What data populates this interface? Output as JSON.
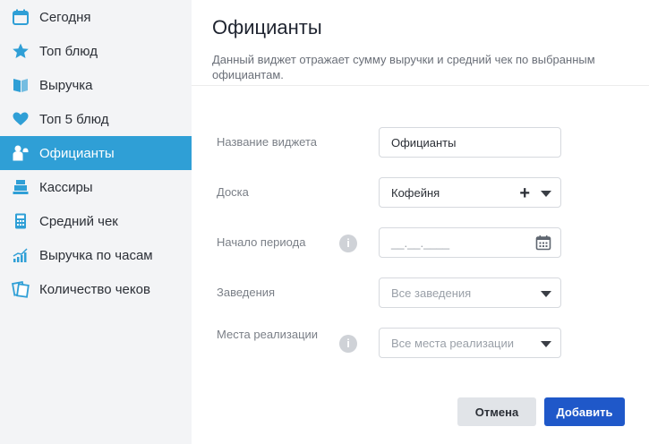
{
  "sidebar": {
    "items": [
      {
        "label": "Сегодня",
        "icon": "calendar-icon",
        "active": false
      },
      {
        "label": "Топ блюд",
        "icon": "star-icon",
        "active": false
      },
      {
        "label": "Выручка",
        "icon": "book-icon",
        "active": false
      },
      {
        "label": "Топ 5 блюд",
        "icon": "heart-icon",
        "active": false
      },
      {
        "label": "Официанты",
        "icon": "waiter-icon",
        "active": true
      },
      {
        "label": "Кассиры",
        "icon": "cash-register-icon",
        "active": false
      },
      {
        "label": "Средний чек",
        "icon": "calculator-icon",
        "active": false
      },
      {
        "label": "Выручка по часам",
        "icon": "chart-icon",
        "active": false
      },
      {
        "label": "Количество чеков",
        "icon": "receipts-icon",
        "active": false
      }
    ],
    "active_color": "#2f9fd6",
    "icon_color": "#2f9fd6"
  },
  "header": {
    "title": "Официанты",
    "description": "Данный виджет отражает сумму выручки и средний чек по выбранным официантам."
  },
  "form": {
    "widget_name": {
      "label": "Название виджета",
      "value": "Официанты"
    },
    "board": {
      "label": "Доска",
      "value": "Кофейня"
    },
    "period_start": {
      "label": "Начало периода",
      "placeholder": "__.__.____"
    },
    "venues": {
      "label": "Заведения",
      "placeholder": "Все заведения"
    },
    "sale_points": {
      "label": "Места реализации",
      "placeholder": "Все места реализации"
    }
  },
  "buttons": {
    "cancel": "Отмена",
    "add": "Добавить",
    "add_color": "#1f58c9"
  }
}
